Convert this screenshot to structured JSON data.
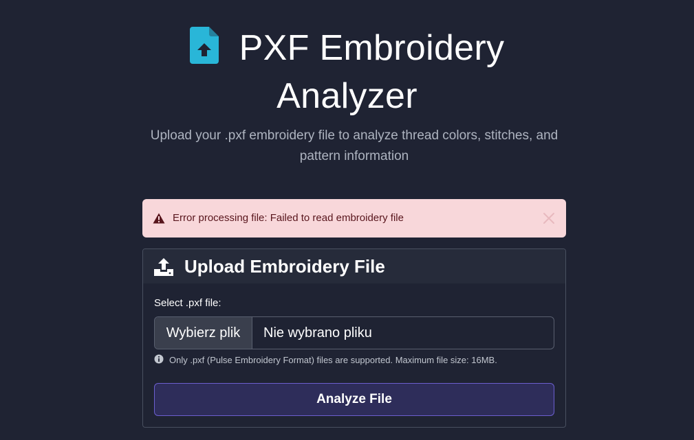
{
  "header": {
    "title_line1": "PXF Embroidery",
    "title_line2": "Analyzer",
    "subtitle": "Upload your .pxf embroidery file to analyze thread colors, stitches, and pattern information",
    "icon": "file-upload-icon"
  },
  "alert": {
    "message": "Error processing file: Failed to read embroidery file",
    "icon": "warning-triangle-icon",
    "close_icon": "close-icon"
  },
  "upload_card": {
    "title": "Upload Embroidery File",
    "icon": "upload-tray-icon",
    "field_label": "Select .pxf file:",
    "file_button_label": "Wybierz plik",
    "file_name": "Nie wybrano pliku",
    "help_text": "Only .pxf (Pulse Embroidery Format) files are supported. Maximum file size: 16MB.",
    "help_icon": "info-circle-icon",
    "submit_label": "Analyze File"
  },
  "colors": {
    "background": "#1f2333",
    "accent": "#29b6d8",
    "alert_bg": "#f8d7da",
    "alert_text": "#58151c",
    "button_border": "#6c5fd0"
  }
}
